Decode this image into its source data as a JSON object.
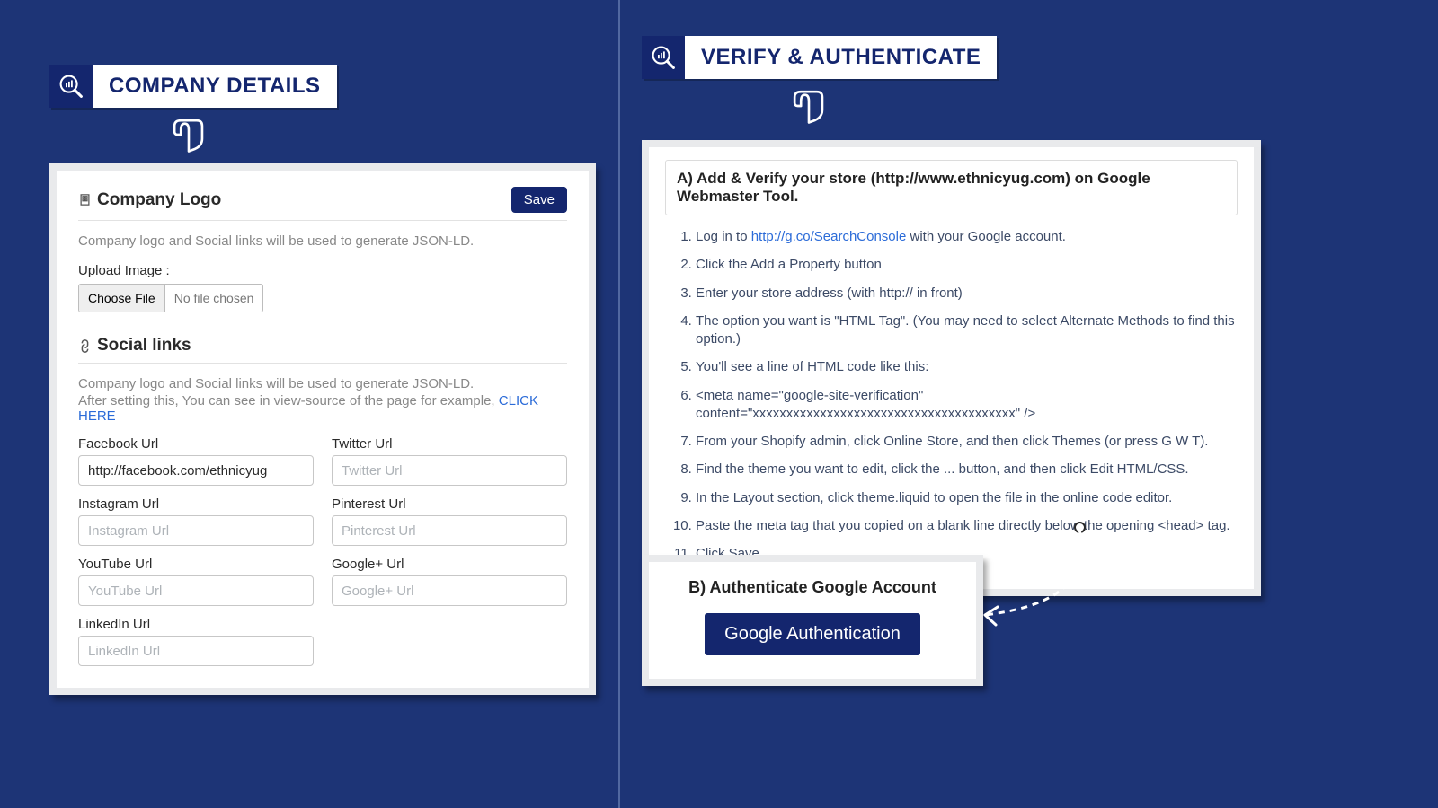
{
  "left": {
    "badge": "COMPANY DETAILS",
    "logo_section": "Company Logo",
    "save": "Save",
    "desc1": "Company logo and Social links will be used to generate JSON-LD.",
    "upload_label": "Upload Image :",
    "choose_file": "Choose File",
    "no_file": "No file chosen",
    "social_section": "Social links",
    "desc2a": "Company logo and Social links will be used to generate JSON-LD.",
    "desc2b": "After setting this, You can see in view-source of the page for example, ",
    "click_here": "CLICK HERE",
    "fields": {
      "facebook_label": "Facebook Url",
      "facebook_value": "http://facebook.com/ethnicyug",
      "twitter_label": "Twitter Url",
      "twitter_ph": "Twitter Url",
      "instagram_label": "Instagram Url",
      "instagram_ph": "Instagram Url",
      "pinterest_label": "Pinterest Url",
      "pinterest_ph": "Pinterest Url",
      "youtube_label": "YouTube Url",
      "youtube_ph": "YouTube Url",
      "gplus_label": "Google+ Url",
      "gplus_ph": "Google+ Url",
      "linkedin_label": "LinkedIn Url",
      "linkedin_ph": "LinkedIn Url"
    }
  },
  "right": {
    "badge": "VERIFY & AUTHENTICATE",
    "heading": "A) Add & Verify your store (http://www.ethnicyug.com) on Google Webmaster Tool.",
    "step1_pre": "Log in to ",
    "step1_link": "http://g.co/SearchConsole",
    "step1_post": " with your Google account.",
    "step2": "Click the Add a Property button",
    "step3": "Enter your store address (with http:// in front)",
    "step4": "The option you want is \"HTML Tag\". (You may need to select Alternate Methods to find this option.)",
    "step5": "You'll see a line of HTML code like this:",
    "step6": "<meta name=\"google-site-verification\" content=\"xxxxxxxxxxxxxxxxxxxxxxxxxxxxxxxxxxxxxxx\" />",
    "step7": "From your Shopify admin, click Online Store, and then click Themes (or press G W T).",
    "step8": "Find the theme you want to edit, click the ... button, and then click Edit HTML/CSS.",
    "step9": "In the Layout section, click theme.liquid to open the file in the online code editor.",
    "step10": "Paste the meta tag that you copied on a blank line directly below the opening <head> tag.",
    "step11": "Click Save.",
    "auth_heading": "B) Authenticate Google Account",
    "auth_button": "Google Authentication"
  }
}
